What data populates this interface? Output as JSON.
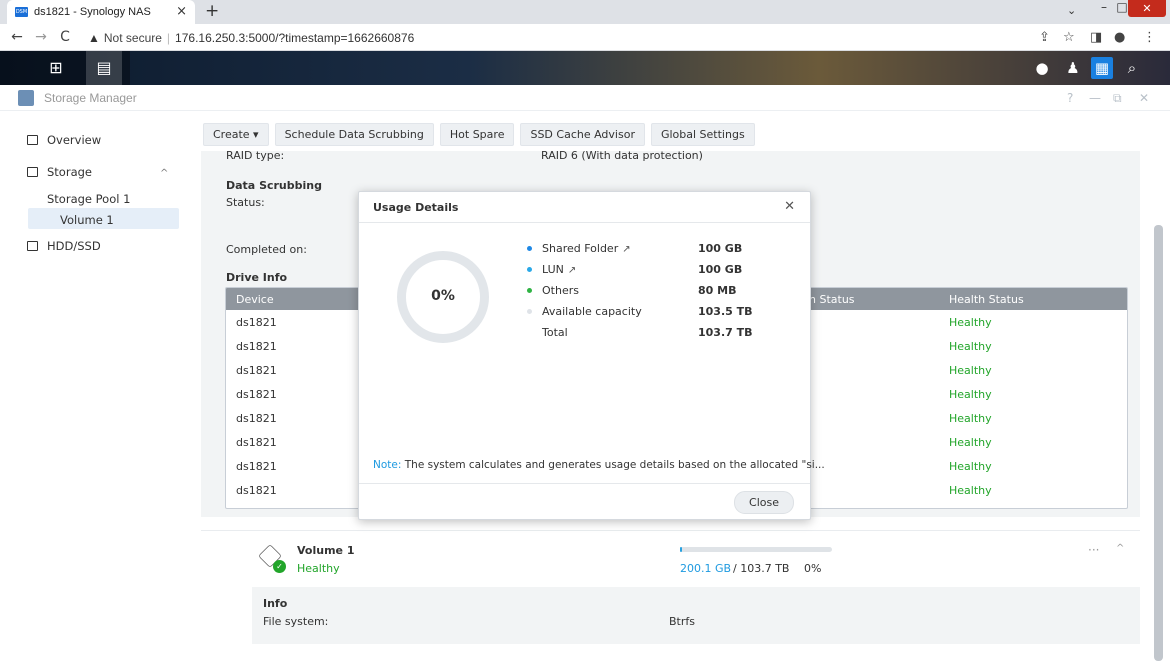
{
  "browser": {
    "tab_title": "ds1821 - Synology NAS",
    "tab_close": "×",
    "new_tab": "+",
    "tab_dropdown": "⌄",
    "win_min": "–",
    "win_max": "□",
    "win_close": "✕",
    "not_secure": "Not secure",
    "url": "176.16.250.3:5000/?timestamp=1662660876",
    "favicon_text": "DSM"
  },
  "app": {
    "title": "Storage Manager",
    "window_controls": [
      "?",
      "—",
      "⧉",
      "✕"
    ]
  },
  "sidebar": {
    "overview": "Overview",
    "storage": "Storage",
    "storage_pool": "Storage Pool 1",
    "volume": "Volume 1",
    "hdd": "HDD/SSD"
  },
  "toolbar": {
    "create": "Create ▾",
    "schedule": "Schedule Data Scrubbing",
    "hot_spare": "Hot Spare",
    "ssd_cache": "SSD Cache Advisor",
    "global": "Global Settings"
  },
  "details": {
    "raid_type_label": "RAID type:",
    "raid_type_value": "RAID 6 (With data protection)",
    "scrubbing_heading": "Data Scrubbing",
    "status_label": "Status:",
    "completed_label": "Completed on:",
    "drive_info_heading": "Drive Info"
  },
  "drive_table": {
    "headers": [
      "Device",
      "n Status",
      "Health Status"
    ],
    "rows": [
      {
        "device": "ds1821",
        "health": "Healthy"
      },
      {
        "device": "ds1821",
        "health": "Healthy"
      },
      {
        "device": "ds1821",
        "health": "Healthy"
      },
      {
        "device": "ds1821",
        "health": "Healthy"
      },
      {
        "device": "ds1821",
        "health": "Healthy"
      },
      {
        "device": "ds1821",
        "health": "Healthy"
      },
      {
        "device": "ds1821",
        "health": "Healthy"
      },
      {
        "device": "ds1821",
        "health": "Healthy"
      }
    ]
  },
  "volume": {
    "name": "Volume 1",
    "status": "Healthy",
    "used": "200.1 GB",
    "total": " / 103.7 TB",
    "percent": "0%",
    "usage_fraction": 0.002,
    "info_heading": "Info",
    "fs_label": "File system:",
    "fs_value": "Btrfs",
    "more": "···",
    "collapse": "^"
  },
  "modal": {
    "title": "Usage Details",
    "close_x": "✕",
    "percent": "0%",
    "legend": [
      {
        "name": "Shared Folder",
        "value": "100 GB",
        "color": "#1e88e5",
        "ext": "↗"
      },
      {
        "name": "LUN",
        "value": "100 GB",
        "color": "#29a8e8",
        "ext": "↗"
      },
      {
        "name": "Others",
        "value": "80 MB",
        "color": "#2fb344",
        "ext": ""
      },
      {
        "name": "Available capacity",
        "value": "103.5 TB",
        "color": "#dfe3e8",
        "ext": ""
      },
      {
        "name": "Total",
        "value": "103.7 TB",
        "color": "",
        "ext": ""
      }
    ],
    "note_prefix": "Note:",
    "note_text": " The system calculates and generates usage details based on the allocated \"si...",
    "close_button": "Close"
  },
  "colors": {
    "accent": "#1e9ae0",
    "healthy": "#22a52a",
    "table_header": "#8f969e"
  }
}
